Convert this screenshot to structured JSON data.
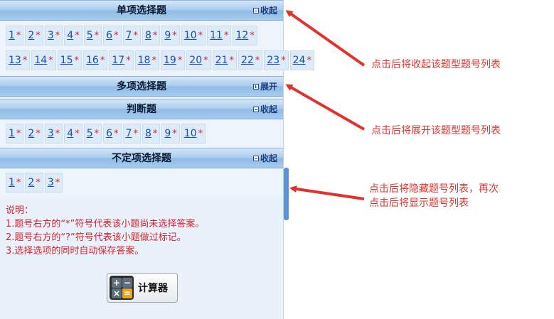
{
  "sections": [
    {
      "title": "单项选择题",
      "toggle_label": "收起",
      "toggle_icon": "collapse-icon",
      "rows": [
        [
          "1",
          "2",
          "3",
          "4",
          "5",
          "6",
          "7",
          "8",
          "9",
          "10",
          "11",
          "12"
        ],
        [
          "13",
          "14",
          "15",
          "16",
          "17",
          "18",
          "19",
          "20",
          "21",
          "22",
          "23",
          "24"
        ]
      ]
    },
    {
      "title": "多项选择题",
      "toggle_label": "展开",
      "toggle_icon": "expand-icon",
      "rows": []
    },
    {
      "title": "判断题",
      "toggle_label": "收起",
      "toggle_icon": "collapse-icon",
      "rows": [
        [
          "1",
          "2",
          "3",
          "4",
          "5",
          "6",
          "7",
          "8",
          "9",
          "10"
        ]
      ]
    },
    {
      "title": "不定项选择题",
      "toggle_label": "收起",
      "toggle_icon": "collapse-icon",
      "rows": [
        [
          "1",
          "2",
          "3"
        ]
      ]
    }
  ],
  "unanswered_mark": "*",
  "notes": {
    "heading": "说明：",
    "lines": [
      "1.题号右方的“*”符号代表该小题尚未选择答案。",
      "2.题号右方的“?”符号代表该小题做过标记。",
      "3.选择选项的同时自动保存答案。"
    ]
  },
  "calculator": {
    "label": "计算器",
    "icon": "calculator-icon",
    "keys": [
      "+",
      "−",
      "×",
      "="
    ]
  },
  "annotations": [
    {
      "text": "点击后将收起该题型题号列表"
    },
    {
      "text": "点击后将展开该题型题号列表"
    },
    {
      "text": "点击后将隐藏题号列表，再次\n点击后将显示题号列表"
    }
  ],
  "colors": {
    "annotation": "#e0332e",
    "link": "#1a4fb8",
    "mark": "#d8222f",
    "header": "#a9cbed"
  }
}
